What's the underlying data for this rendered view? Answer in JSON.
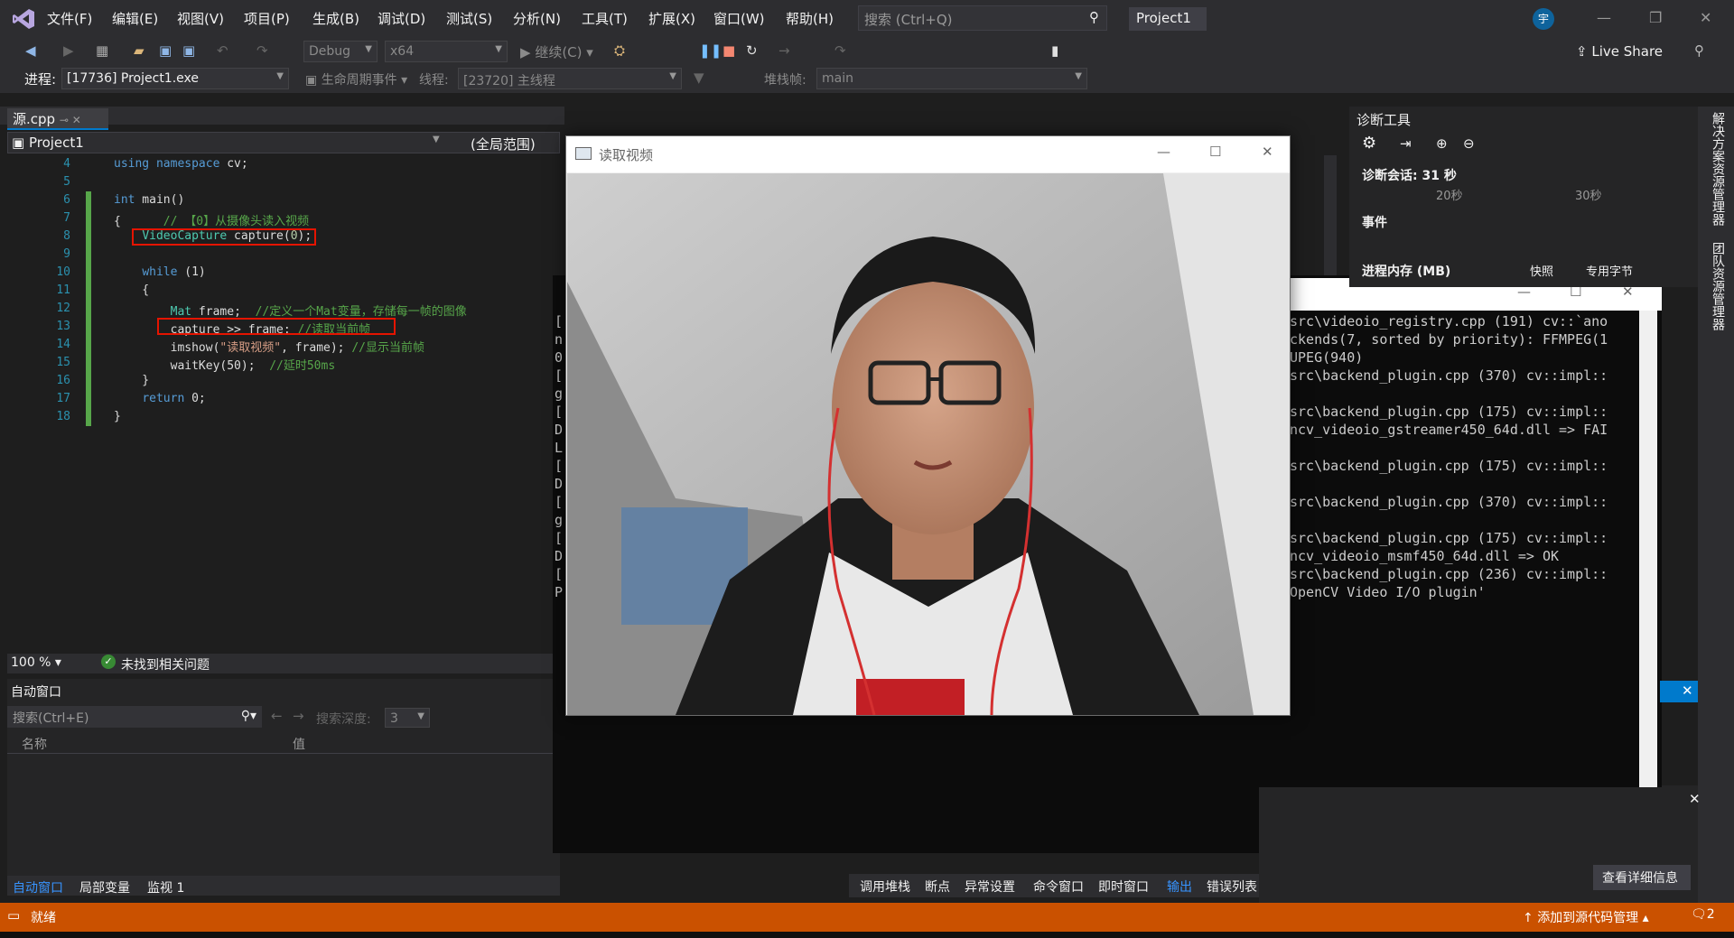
{
  "menu": [
    "文件(F)",
    "编辑(E)",
    "视图(V)",
    "项目(P)",
    "生成(B)",
    "调试(D)",
    "测试(S)",
    "分析(N)",
    "工具(T)",
    "扩展(X)",
    "窗口(W)",
    "帮助(H)"
  ],
  "search": {
    "placeholder": "搜索 (Ctrl+Q)"
  },
  "project_title": "Project1",
  "avatar_initial": "宇",
  "live_share": "Live Share",
  "toolbar": {
    "config": "Debug",
    "platform": "x64",
    "continue": "继续(C)"
  },
  "debugbar": {
    "process_label": "进程:",
    "process_value": "[17736] Project1.exe",
    "lifecycle": "生命周期事件",
    "thread_label": "线程:",
    "thread_value": "[23720] 主线程",
    "stack_label": "堆栈帧:",
    "stack_value": "main"
  },
  "editor": {
    "tab": "源.cpp",
    "project_combo": "Project1",
    "scope_combo": "(全局范围)",
    "lines": [
      {
        "n": "4",
        "html": "<span class='kw'>using namespace</span> cv;"
      },
      {
        "n": "5",
        "html": ""
      },
      {
        "n": "6",
        "html": "<span class='kw'>int</span> main()"
      },
      {
        "n": "7",
        "html": "{      <span class='cm'>// 【0】从摄像头读入视频</span>"
      },
      {
        "n": "8",
        "html": "    <span class='ty'>VideoCapture</span> capture(<span style='color:#b5cea8'>0</span>);"
      },
      {
        "n": "9",
        "html": ""
      },
      {
        "n": "10",
        "html": "    <span class='kw'>while</span> (1)"
      },
      {
        "n": "11",
        "html": "    {"
      },
      {
        "n": "12",
        "html": "        <span class='ty'>Mat</span> frame;  <span class='cm'>//定义一个Mat变量，存储每一帧的图像</span>"
      },
      {
        "n": "13",
        "html": "        capture >> frame; <span class='cm'>//读取当前帧</span>"
      },
      {
        "n": "14",
        "html": "        imshow(<span class='st'>\"读取视频\"</span>, frame); <span class='cm'>//显示当前帧</span>"
      },
      {
        "n": "15",
        "html": "        waitKey(50);  <span class='cm'>//延时50ms</span>"
      },
      {
        "n": "16",
        "html": "    }"
      },
      {
        "n": "17",
        "html": "    <span class='kw'>return</span> 0;"
      },
      {
        "n": "18",
        "html": "}"
      }
    ],
    "zoom": "100 %",
    "issues": "未找到相关问题"
  },
  "autos": {
    "title": "自动窗口",
    "search_placeholder": "搜索(Ctrl+E)",
    "depth_label": "搜索深度:",
    "depth_value": "3",
    "col_name": "名称",
    "col_value": "值",
    "tabs": [
      "自动窗口",
      "局部变量",
      "监视 1"
    ]
  },
  "cv_window": {
    "title": "读取视频"
  },
  "console": {
    "lines": [
      "src\\videoio_registry.cpp (191) cv::`ano",
      "ckends(7, sorted by priority): FFMPEG(1",
      "UPEG(940)",
      "src\\backend_plugin.cpp (370) cv::impl::",
      "",
      "src\\backend_plugin.cpp (175) cv::impl::",
      "ncv_videoio_gstreamer450_64d.dll => FAI",
      "",
      "src\\backend_plugin.cpp (175) cv::impl::",
      "",
      "src\\backend_plugin.cpp (370) cv::impl::",
      "",
      "src\\backend_plugin.cpp (175) cv::impl::",
      "ncv_videoio_msmf450_64d.dll => OK",
      "src\\backend_plugin.cpp (236) cv::impl::",
      "OpenCV Video I/O plugin'"
    ],
    "left_fragments": [
      "[",
      "n",
      "0(",
      "[",
      "g",
      "[",
      "D",
      "L",
      "[",
      "D",
      "[",
      "g",
      "[",
      "D",
      "[",
      "P"
    ]
  },
  "diag": {
    "title": "诊断工具",
    "session": "诊断会话: 31 秒",
    "tick1": "20秒",
    "tick2": "30秒",
    "events": "事件",
    "memory": "进程内存 (MB)",
    "snapshot": "快照",
    "private_bytes": "专用字节"
  },
  "bottom_tabs": [
    "调用堆栈",
    "断点",
    "异常设置",
    "命令窗口",
    "即时窗口",
    "输出",
    "错误列表"
  ],
  "details_button": "查看详细信息",
  "right_side": [
    "解决方案资源管理器",
    "团队资源管理器"
  ],
  "status": {
    "ready": "就绪",
    "source_control": "添加到源代码管理",
    "notifications": "2"
  }
}
